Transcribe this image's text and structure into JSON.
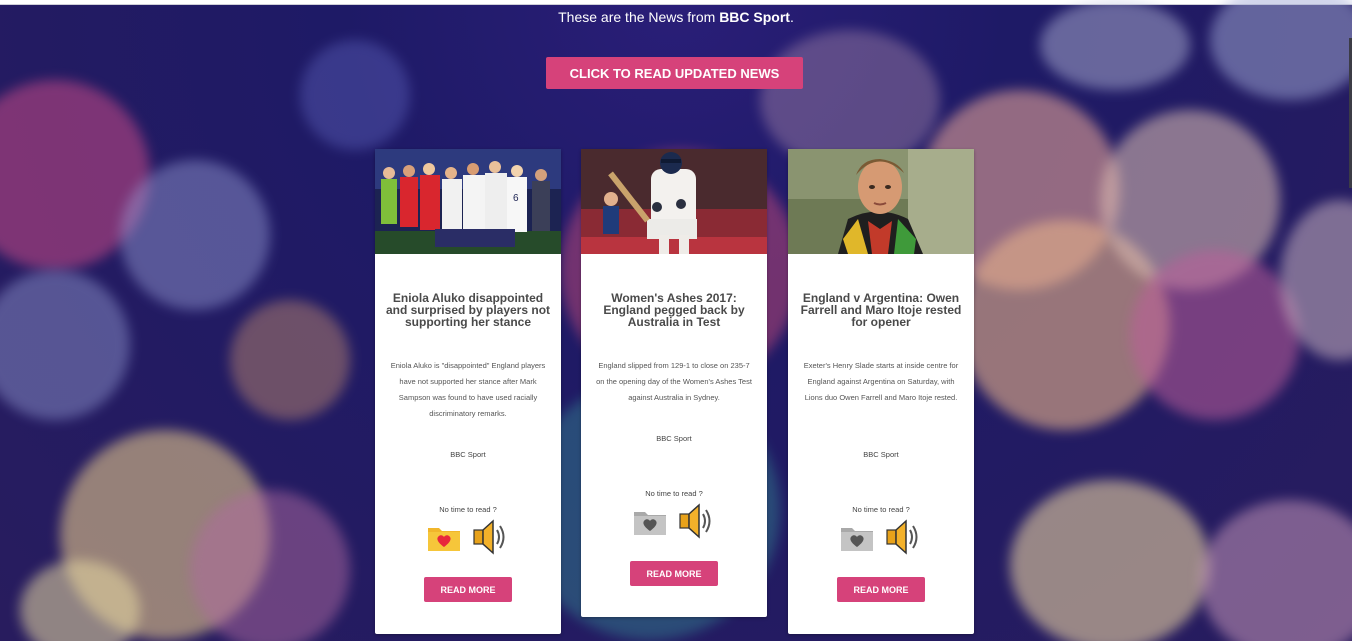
{
  "header": {
    "text_prefix": "These are the News from ",
    "text_bold": "BBC Sport",
    "text_suffix": "."
  },
  "cta_label": "CLICK TO READ UPDATED NEWS",
  "cards": [
    {
      "title": "Eniola Aluko disappointed and surprised by players not supporting her stance",
      "description": "Eniola Aluko is \"disappointed\" England players have not supported her stance after Mark Sampson was found to have used racially discriminatory remarks.",
      "source": "BBC Sport",
      "no_time": "No time to read ?",
      "favorite_state": "favorited",
      "read_more": "READ MORE"
    },
    {
      "title": "Women's Ashes 2017: England pegged back by Australia in Test",
      "description": "England slipped from 129-1 to close on 235-7 on the opening day of the Women's Ashes Test against Australia in Sydney.",
      "source": "BBC Sport",
      "no_time": "No time to read ?",
      "favorite_state": "not-favorited",
      "read_more": "READ MORE"
    },
    {
      "title": "England v Argentina: Owen Farrell and Maro Itoje rested for opener",
      "description": "Exeter's Henry Slade starts at inside centre for England against Argentina on Saturday, with Lions duo Owen Farrell and Maro Itoje rested.",
      "source": "BBC Sport",
      "no_time": "No time to read ?",
      "favorite_state": "not-favorited",
      "read_more": "READ MORE"
    }
  ],
  "colors": {
    "accent": "#d6427a",
    "background": "#1e1a66",
    "card": "#ffffff"
  },
  "icons": [
    "favorite-folder-icon",
    "speaker-icon"
  ]
}
